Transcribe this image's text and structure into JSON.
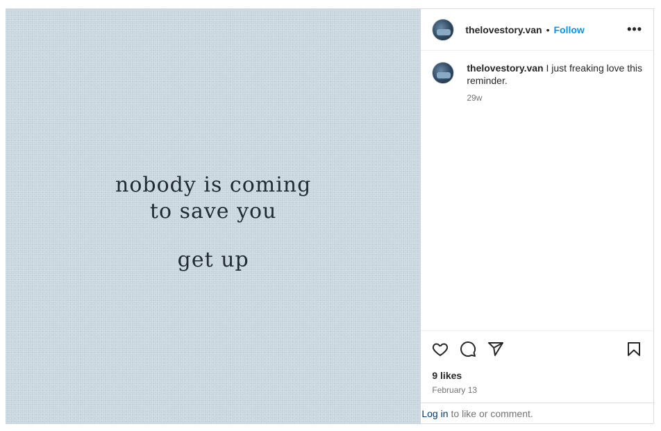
{
  "media": {
    "lines": [
      "nobody is coming",
      "to save you",
      "get up"
    ]
  },
  "header": {
    "username": "thelovestory.van",
    "separator": "•",
    "follow_label": "Follow",
    "more_label": "•••"
  },
  "caption": {
    "username": "thelovestory.van",
    "text": "I just freaking love this reminder.",
    "time": "29w"
  },
  "stats": {
    "likes": "9 likes",
    "date": "February 13"
  },
  "login": {
    "link": "Log in",
    "text": "to like or comment."
  },
  "colors": {
    "accent": "#0095f6",
    "link": "#00376b",
    "muted": "#737373"
  },
  "icons": [
    "heart-icon",
    "comment-icon",
    "share-icon",
    "bookmark-icon",
    "more-icon"
  ]
}
